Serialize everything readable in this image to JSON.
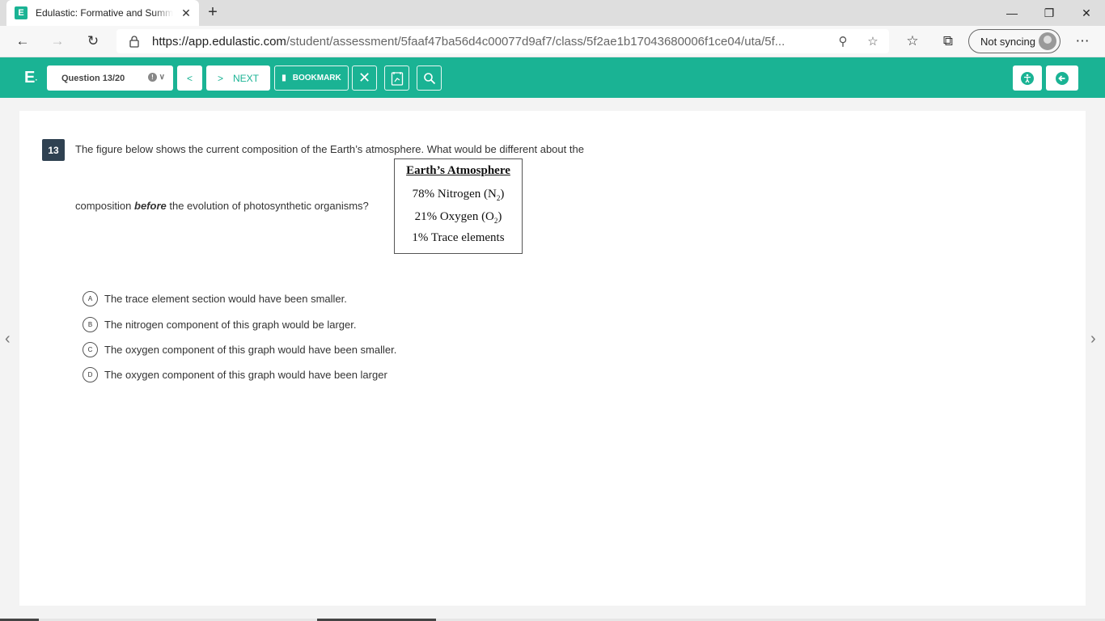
{
  "browser": {
    "tab_title": "Edulastic: Formative and Summative Assessments Made Easy",
    "favicon_letter": "E",
    "url_domain": "https://app.edulastic.com",
    "url_path": "/student/assessment/5faaf47ba56d4c00077d9af7/class/5f2ae1b17043680006f1ce04/uta/5f...",
    "sync_label": "Not syncing"
  },
  "header": {
    "logo": "E",
    "question_selector": "Question 13/20",
    "next_label": "NEXT",
    "bookmark_label": "BOOKMARK",
    "brand_color": "#1ab394"
  },
  "question": {
    "number": "13",
    "text_line1": "The figure below shows the current composition of the Earth’s atmosphere. What would be different about the",
    "text_line2_start": "composition",
    "text_line2_emph": "before",
    "text_line2_end": "the evolution of photosynthetic organisms?",
    "figure": {
      "title": "Earth’s Atmosphere",
      "row1": "78% Nitrogen (N",
      "row1_sub": "2",
      "row2": "21% Oxygen (O",
      "row2_sub": "2",
      "row3": "1% Trace elements"
    },
    "options": [
      {
        "letter": "A",
        "text": "The trace element section would have been smaller."
      },
      {
        "letter": "B",
        "text": "The nitrogen component of this graph would be larger."
      },
      {
        "letter": "C",
        "text": "The oxygen component of this graph would have been smaller."
      },
      {
        "letter": "D",
        "text": "The oxygen component of this graph would have been larger"
      }
    ]
  }
}
